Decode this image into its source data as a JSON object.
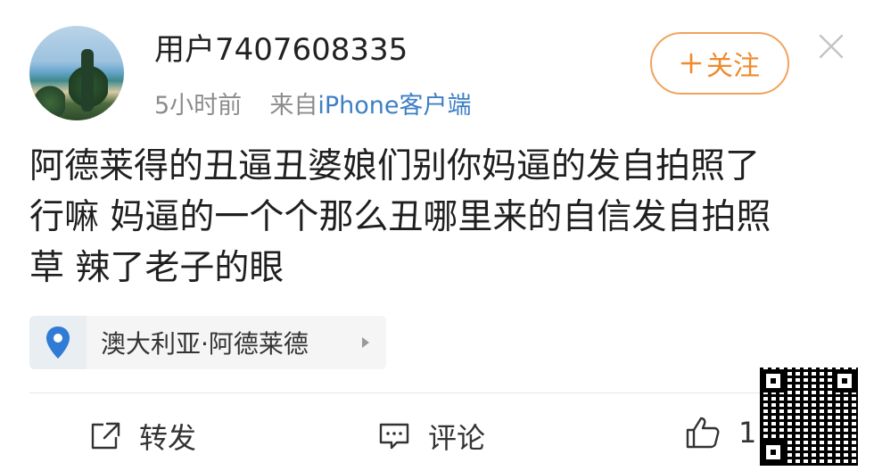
{
  "post": {
    "username": "用户7407608335",
    "time_ago": "5小时前",
    "source_prefix": "来自",
    "device": "iPhone客户端",
    "follow_label": "关注",
    "content": "阿德莱得的丑逼丑婆娘们别你妈逼的发自拍照了\n行嘛 妈逼的一个个那么丑哪里来的自信发自拍照\n草 辣了老子的眼",
    "location": "澳大利亚·阿德莱德"
  },
  "actions": {
    "repost_label": "转发",
    "comment_label": "评论",
    "like_count": "1"
  },
  "icons": {
    "follow": "plus-icon",
    "close": "close-icon",
    "location": "map-pin-icon",
    "repost": "share-icon",
    "comment": "comment-icon",
    "like": "thumbs-up-icon"
  },
  "colors": {
    "accent": "#f08a2c",
    "link": "#3d7fc4",
    "pin": "#2f7bd6"
  }
}
